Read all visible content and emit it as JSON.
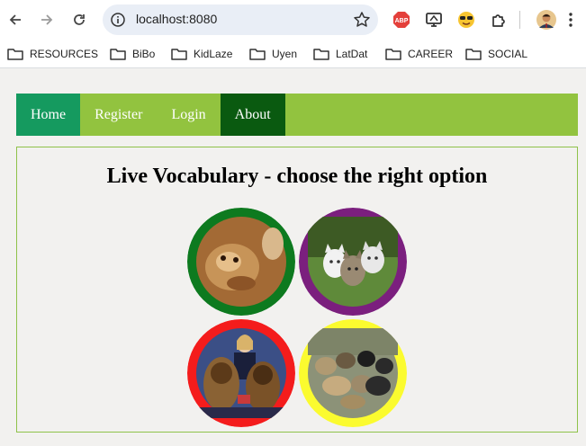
{
  "browser": {
    "url": "localhost:8080",
    "extensions": [
      {
        "name": "adblock-icon",
        "label": "ABP",
        "color": "#e4403b"
      },
      {
        "name": "screen-monitor-icon"
      },
      {
        "name": "sunglasses-emoji-icon"
      },
      {
        "name": "puzzle-extensions-icon"
      }
    ],
    "bookmarks": [
      "RESOURCES",
      "BiBo",
      "KidLaze",
      "Uyen",
      "LatDat",
      "CAREER",
      "SOCIAL"
    ]
  },
  "nav": {
    "items": [
      "Home",
      "Register",
      "Login",
      "About"
    ],
    "colors": {
      "bar": "#92c33f",
      "home": "#159a5f",
      "about": "#0a5a10"
    }
  },
  "quiz": {
    "title": "Live Vocabulary - choose the right option",
    "options": [
      {
        "image": "monkey",
        "ring_color": "#0d7a1f"
      },
      {
        "image": "kittens",
        "ring_color": "#7b1f7e"
      },
      {
        "image": "dogs with girl",
        "ring_color": "#f41c1c"
      },
      {
        "image": "dogs on grass",
        "ring_color": "#fbfb2f"
      }
    ]
  }
}
